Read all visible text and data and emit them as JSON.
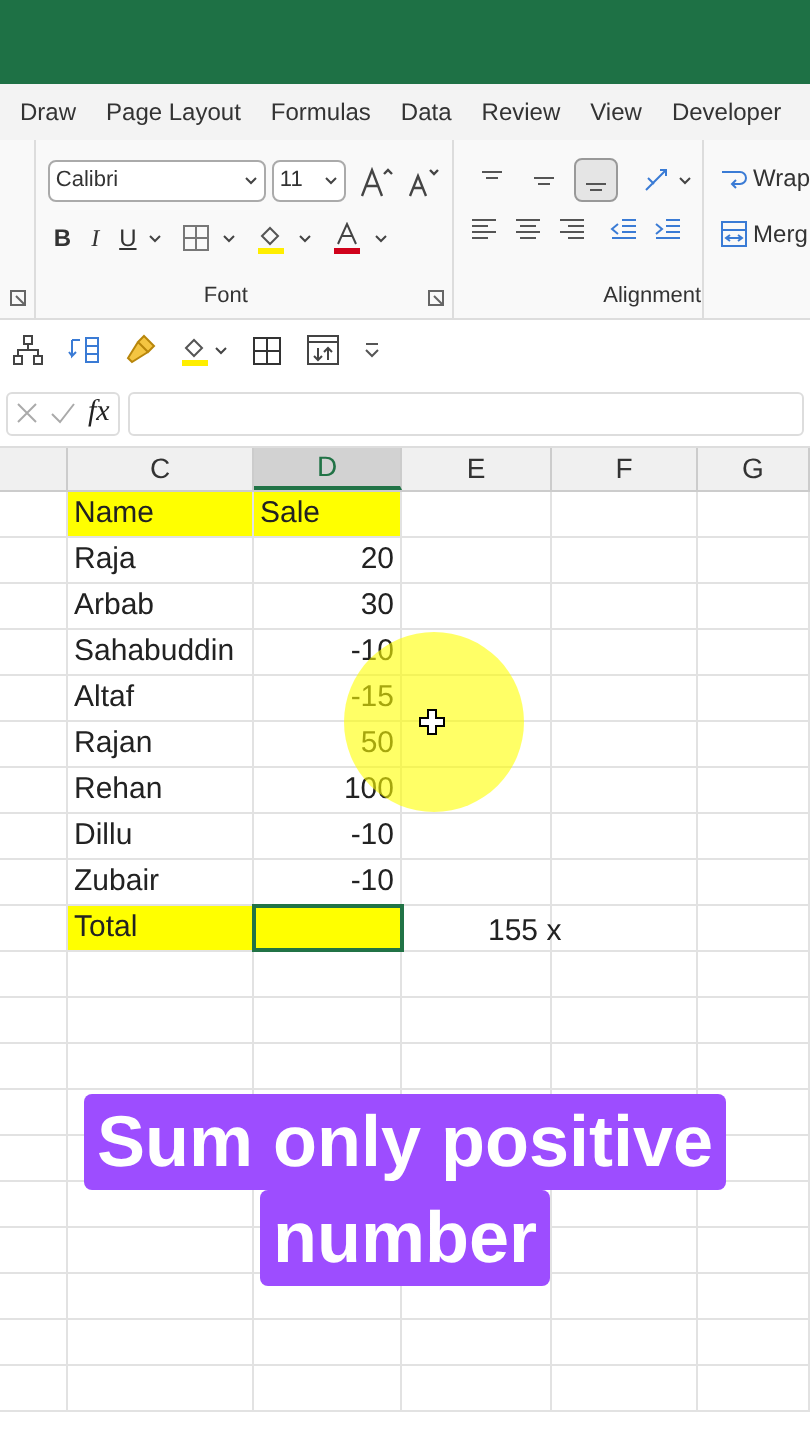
{
  "ribbon_tabs": [
    "Draw",
    "Page Layout",
    "Formulas",
    "Data",
    "Review",
    "View",
    "Developer"
  ],
  "font_group": {
    "font_name": "Calibri",
    "font_size": "11",
    "style_buttons": [
      "B",
      "I",
      "U"
    ],
    "label": "Font"
  },
  "alignment_group": {
    "label": "Alignment",
    "vertical_selected": [
      false,
      false,
      true
    ]
  },
  "wrap_group": {
    "wrap": "Wrap",
    "merge": "Merg"
  },
  "formula_bar": {
    "fx": "fx"
  },
  "columns": [
    {
      "label": "C",
      "selected": false
    },
    {
      "label": "D",
      "selected": true
    },
    {
      "label": "E",
      "selected": false
    },
    {
      "label": "F",
      "selected": false
    },
    {
      "label": "G",
      "selected": false
    }
  ],
  "rows": [
    {
      "name": "Name",
      "sale": "Sale",
      "highlight": true,
      "selected": false
    },
    {
      "name": "Raja",
      "sale": "20",
      "highlight": false,
      "selected": false
    },
    {
      "name": "Arbab",
      "sale": "30",
      "highlight": false,
      "selected": false
    },
    {
      "name": "Sahabuddin",
      "sale": "-10",
      "highlight": false,
      "selected": false
    },
    {
      "name": "Altaf",
      "sale": "-15",
      "highlight": false,
      "selected": false
    },
    {
      "name": "Rajan",
      "sale": "50",
      "highlight": false,
      "selected": false
    },
    {
      "name": "Rehan",
      "sale": "100",
      "highlight": false,
      "selected": false
    },
    {
      "name": "Dillu",
      "sale": "-10",
      "highlight": false,
      "selected": false
    },
    {
      "name": "Zubair",
      "sale": "-10",
      "highlight": false,
      "selected": false
    },
    {
      "name": "Total",
      "highlight": true,
      "selected": true,
      "note": "155 x"
    }
  ],
  "caption": [
    "Sum only positive",
    "number"
  ]
}
